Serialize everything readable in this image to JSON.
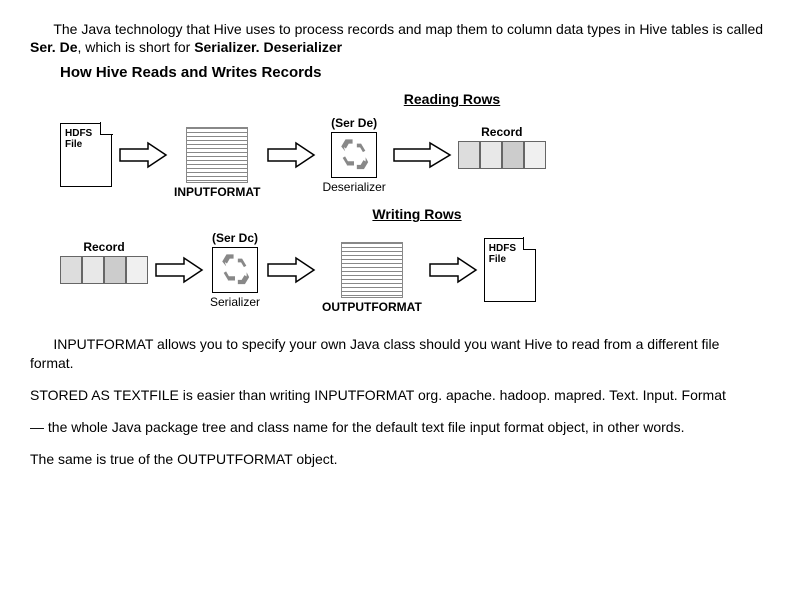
{
  "intro": {
    "p1a": "The Java technology that Hive uses to process records and map them to column data types in Hive tables is called ",
    "p1b": "Ser. De",
    "p1c": ", which is short for ",
    "p1d": "Serializer. Deserializer"
  },
  "diagram": {
    "title": "How Hive Reads and Writes Records",
    "reading_label": "Reading Rows",
    "writing_label": "Writing Rows",
    "hdfs": "HDFS\nFile",
    "inputformat": "INPUTFORMAT",
    "serde": "(Ser De)",
    "serdc": "(Ser Dc)",
    "deserializer": "Deserializer",
    "serializer": "Serializer",
    "record": "Record",
    "outputformat": "OUTPUTFORMAT"
  },
  "body": {
    "p2": "INPUTFORMAT allows you to specify your own Java class should you want Hive to read from a different file format.",
    "p3": "STORED AS TEXTFILE is easier than writing INPUTFORMAT org. apache. hadoop. mapred. Text. Input. Format",
    "p4": " — the whole Java package tree and class name for the default text file input format object, in other words.",
    "p5": "The same is true of the OUTPUTFORMAT object."
  }
}
